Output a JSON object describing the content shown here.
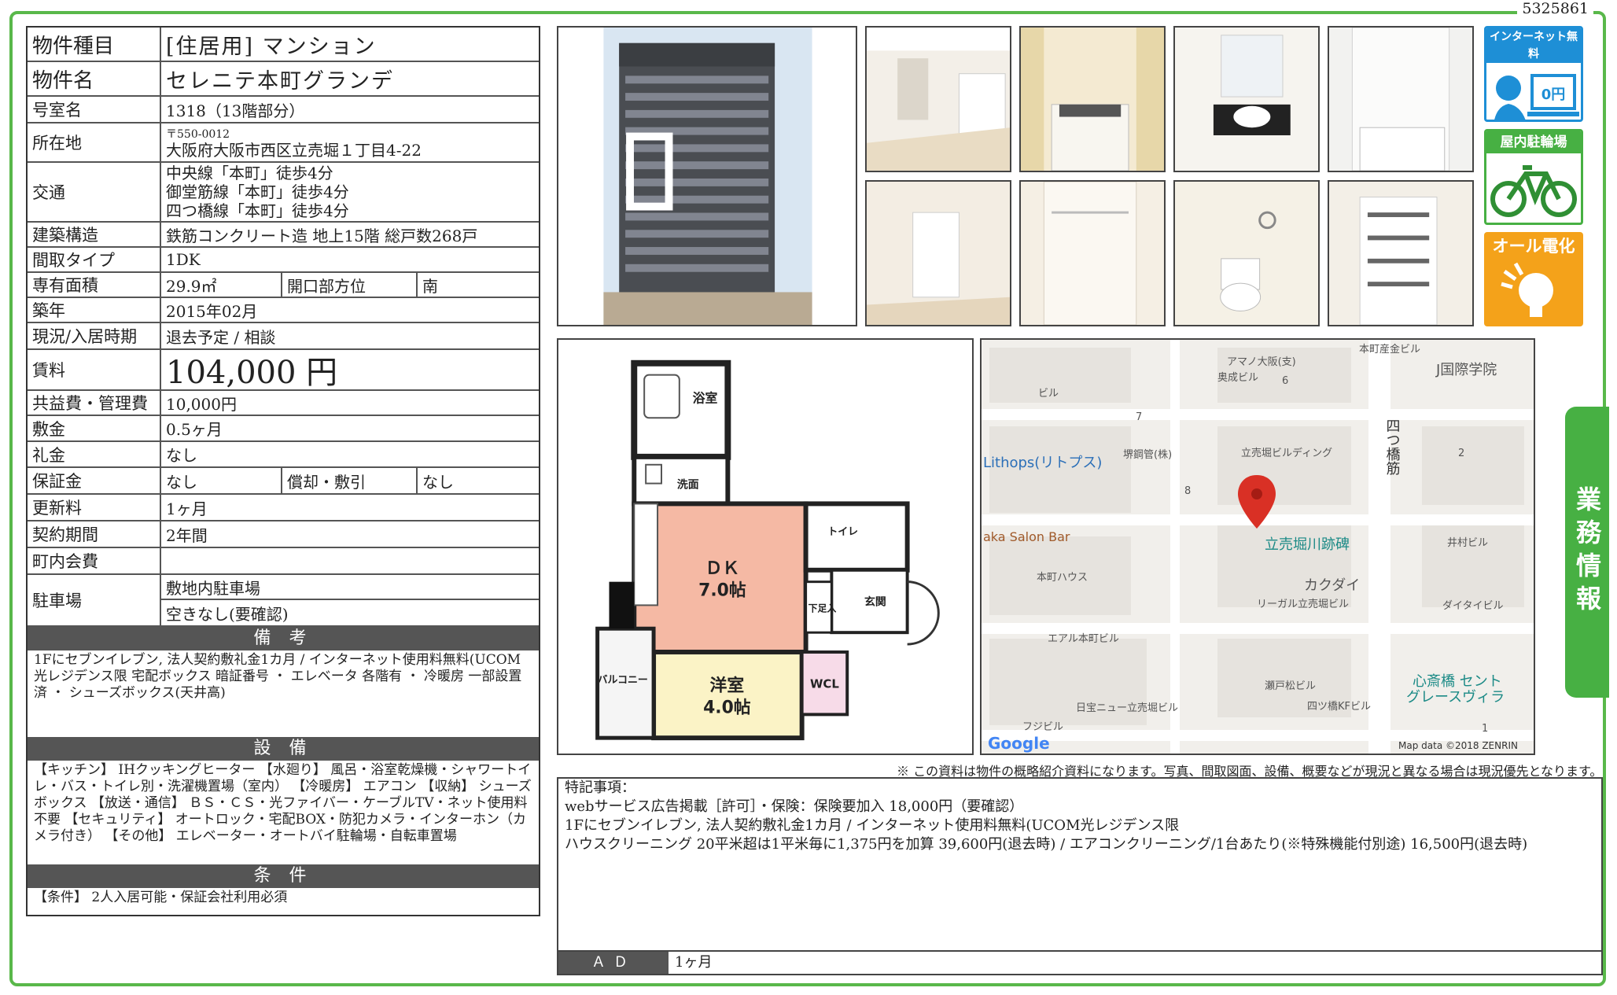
{
  "doc_id": "5325861",
  "property": {
    "type_label": "物件種目",
    "type_value": "[住居用]  マンション",
    "name_label": "物件名",
    "name_value": "セレニテ本町グランデ",
    "room_label": "号室名",
    "room_value": "1318（13階部分）",
    "address_label": "所在地",
    "postal": "〒550-0012",
    "address": "大阪府大阪市西区立売堀１丁目4-22",
    "access_label": "交通",
    "access": [
      "中央線「本町」徒歩4分",
      "御堂筋線「本町」徒歩4分",
      "四つ橋線「本町」徒歩4分"
    ],
    "structure_label": "建築構造",
    "structure_value": "鉄筋コンクリート造 地上15階 総戸数268戸",
    "layout_label": "間取タイプ",
    "layout_value": "1DK",
    "area_label": "専有面積",
    "area_value": "29.9㎡",
    "direction_label": "開口部方位",
    "direction_value": "南",
    "built_label": "築年",
    "built_value": "2015年02月",
    "status_label": "現況/入居時期",
    "status_value": "退去予定 / 相談",
    "rent_label": "賃料",
    "rent_value": "104,000 円",
    "fee_label": "共益費・管理費",
    "fee_value": "10,000円",
    "deposit_label": "敷金",
    "deposit_value": "0.5ヶ月",
    "key_label": "礼金",
    "key_value": "なし",
    "guarantee_label": "保証金",
    "guarantee_value": "なし",
    "amort_label": "償却・敷引",
    "amort_value": "なし",
    "renewal_label": "更新料",
    "renewal_value": "1ヶ月",
    "term_label": "契約期間",
    "term_value": "2年間",
    "assoc_label": "町内会費",
    "assoc_value": "",
    "parking_label": "駐車場",
    "parking_value1": "敷地内駐車場",
    "parking_value2": "空きなし(要確認)"
  },
  "remarks": {
    "title": "備 考",
    "text": "1Fにセブンイレブン, 法人契約敷礼金1カ月 / インターネット使用料無料(UCOM光レジデンス限 宅配ボックス 暗証番号 ・ エレベータ 各階有 ・ 冷暖房 一部設置済 ・ シューズボックス(天井高)"
  },
  "equipment": {
    "title": "設 備",
    "text": "【キッチン】 IHクッキングヒーター 【水廻り】 風呂・浴室乾燥機・シャワートイレ・バス・トイレ別・洗濯機置場（室内） 【冷暖房】 エアコン 【収納】 シューズボックス 【放送・通信】 ＢＳ・ＣＳ・光ファイバー・ケーブルTV・ネット使用料不要 【セキュリティ】 オートロック・宅配BOX・防犯カメラ・インターホン（カメラ付き） 【その他】 エレベーター・オートバイ駐輪場・自転車置場"
  },
  "conditions": {
    "title": "条 件",
    "text": "【条件】 2人入居可能・保証会社利用必須"
  },
  "badges": {
    "internet": "インターネット無料",
    "internet_price": "0円",
    "bike": "屋内駐輪場",
    "electric": "オール電化"
  },
  "side_tab": "業務情報",
  "floorplan": {
    "bath": "浴室",
    "wash": "洗面",
    "dk": "ＤＫ",
    "dk_size": "7.0帖",
    "toilet": "トイレ",
    "geta": "下足入",
    "entrance": "玄関",
    "balcony": "バルコニー",
    "western": "洋室",
    "western_size": "4.0帖",
    "wcl": "WCL"
  },
  "map": {
    "labels": [
      "本町産金ビル",
      "アマノ大阪(支)",
      "奥成ビル",
      "6",
      "ビル",
      "J国際学院",
      "7",
      "四つ橋筋",
      "Lithops(リトプス)",
      "堺鋼管(株)",
      "立売堀ビルディング",
      "2",
      "8",
      "aka Salon Bar",
      "立売堀川跡碑",
      "井村ビル",
      "本町ハウス",
      "カクダイ",
      "リーガル立売堀ビル",
      "ダイタイビル",
      "エアル本町ビル",
      "瀬戸松ビル",
      "心斎橋 セント",
      "グレースヴィラ",
      "日宝ニュー立売堀ビル",
      "四ツ橋KFビル",
      "フジビル",
      "1"
    ],
    "google": "Google",
    "copyright": "Map data ©2018 ZENRIN"
  },
  "disclaimer": "※ この資料は物件の概略紹介資料になります。写真、間取図面、設備、概要などが現況と異なる場合は現況優先となります。",
  "notes": {
    "title": "特記事項：",
    "lines": [
      "webサービス広告掲載［許可］・保険：保険要加入 18,000円（要確認）",
      "1Fにセブンイレブン, 法人契約敷礼金1カ月 / インターネット使用料無料(UCOM光レジデンス限",
      "ハウスクリーニング 20平米超は1平米毎に1,375円を加算 39,600円(退去時) / エアコンクリーニング/1台あたり(※特殊機能付別途) 16,500円(退去時)"
    ]
  },
  "ad": {
    "label": "ＡＤ",
    "value": "1ヶ月"
  },
  "colors": {
    "frame": "#59b84a",
    "header": "#555555",
    "badge_blue": "#1e8fd6",
    "badge_green": "#47b043",
    "badge_orange": "#f4a21a",
    "dk_room": "#f5b9a4",
    "western_room": "#fbf3c6",
    "wcl_room": "#f7dbe8"
  }
}
